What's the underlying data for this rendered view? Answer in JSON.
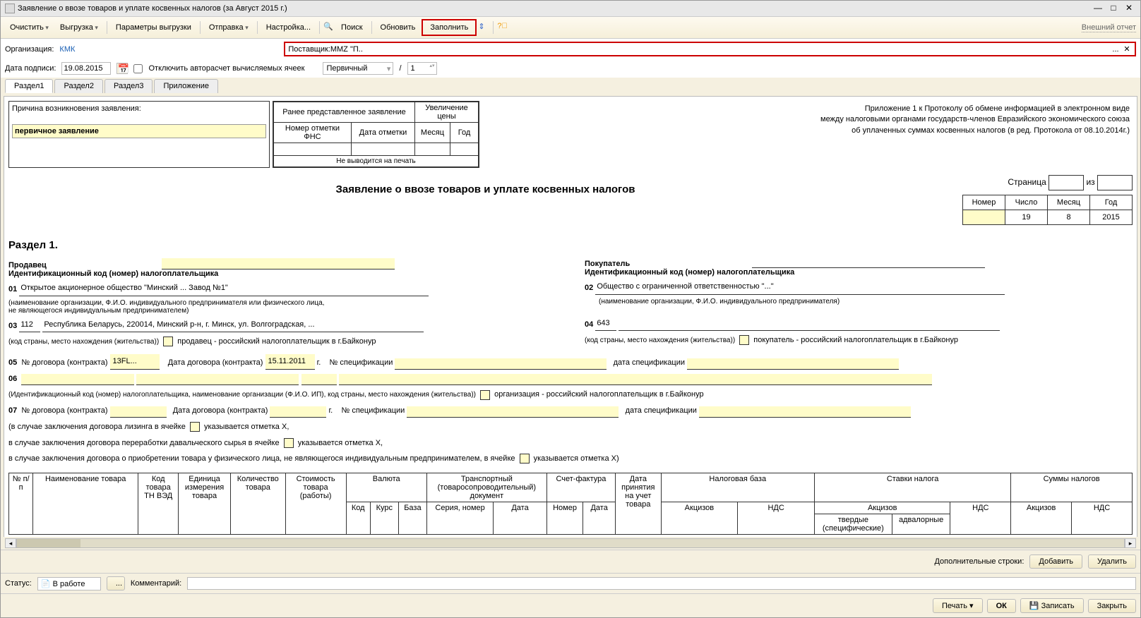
{
  "window": {
    "title": "Заявление о ввозе товаров и уплате косвенных налогов (за Август 2015 г.)"
  },
  "toolbar": {
    "clear": "Очистить",
    "unload": "Выгрузка",
    "unload_params": "Параметры выгрузки",
    "send": "Отправка",
    "settings": "Настройка...",
    "search": "Поиск",
    "refresh": "Обновить",
    "fill": "Заполнить",
    "ext_report": "Внешний отчет"
  },
  "header": {
    "org_label": "Организация:",
    "org": "КМК",
    "supplier_label": "Поставщик:",
    "supplier": "MMZ \"П..",
    "date_label": "Дата подписи:",
    "date": "19.08.2015",
    "autocalc_label": "Отключить авторасчет вычисляемых ячеек",
    "kind": "Первичный",
    "slash": "/",
    "num": "1"
  },
  "tabs": {
    "t1": "Раздел1",
    "t2": "Раздел2",
    "t3": "Раздел3",
    "t4": "Приложение"
  },
  "doc": {
    "reason_title": "Причина возникновения заявления:",
    "reason_val": "первичное заявление",
    "prev": {
      "title": "Ранее представленное заявление",
      "fns": "Номер отметки ФНС",
      "date": "Дата отметки",
      "noprint": "Не выводится на печать"
    },
    "increase": {
      "title": "Увеличение цены",
      "month": "Месяц",
      "year": "Год"
    },
    "appendix": {
      "l1": "Приложение 1 к Протоколу об обмене информацией в электронном виде",
      "l2": "между налоговыми органами государств-членов Евразийского экономического союза",
      "l3": "об уплаченных суммах косвенных налогов (в ред. Протокола от 08.10.2014г.)"
    },
    "title": "Заявление о ввозе товаров и уплате косвенных налогов",
    "page": {
      "label": "Страница",
      "of": "из",
      "num_h": "Номер",
      "day_h": "Число",
      "mon_h": "Месяц",
      "year_h": "Год",
      "day": "19",
      "mon": "8",
      "year": "2015"
    },
    "section_h": "Раздел 1.",
    "seller_h": "Продавец",
    "buyer_h": "Покупатель",
    "id_code": "Идентификационный код (номер) налогоплательщика",
    "l01": "01",
    "l01_text": "Открытое акционерное общество \"Минский ... Завод №1\"",
    "l01_sub1": "(наименование организации, Ф.И.О. индивидуального предпринимателя или физического лица,",
    "l01_sub2": "не являющегося индивидуальным предпринимателем)",
    "l02": "02",
    "l02_text": "Общество с ограниченной ответственностью \"...\"",
    "l02_sub": "(наименование организации, Ф.И.О. индивидуального предпринимателя)",
    "l03": "03",
    "l03_code": "112",
    "l03_addr": "Республика Беларусь, 220014, Минский р-н, г. Минск, ул. Волгоградская, ...",
    "l04": "04",
    "l04_code": "643",
    "addr_sub": "(код страны, место нахождения (жительства))",
    "baikonur_seller": "продавец - российский налогоплательщик в г.Байконур",
    "baikonur_buyer": "покупатель - российский налогоплательщик в г.Байконур",
    "l05": "05",
    "contract_num": "№ договора (контракта)",
    "contract_val": "13FL...",
    "contract_date_lbl": "Дата договора (контракта)",
    "contract_date": "15.11.2011",
    "g": "г.",
    "spec_num": "№ спецификации",
    "spec_date": "дата спецификации",
    "l06": "06",
    "l06_sub": "(Идентификационный код (номер) налогоплательщика, наименование организации (Ф.И.О. ИП), код страны, место нахождения (жительства))",
    "baikonur_org": "организация - российский налогоплательщик в г.Байконур",
    "l07": "07",
    "leasing": "(в случае заключения договора лизинга в ячейке",
    "mark_x": "указывается отметка Х,",
    "davai": "в случае заключения договора переработки давальческого сырья в ячейке",
    "fizlico": "в случае заключения договора о приобретении товара у физического лица, не являющегося индивидуальным предпринимателем, в ячейке",
    "mark_x_end": "указывается отметка Х)"
  },
  "table": {
    "c1": "№ п/п",
    "c2": "Наименование товара",
    "c3": "Код товара ТН ВЭД",
    "c4": "Единица измерения товара",
    "c5": "Количество товара",
    "c6": "Стоимость товара (работы)",
    "c7": "Валюта",
    "c8": "Транспортный (товаросопроводительный) документ",
    "c9": "Счет-фактура",
    "c10": "Дата принятия на учет товара",
    "c11": "Налоговая база",
    "c12": "Ставки налога",
    "c13": "Суммы налогов",
    "kod": "Код",
    "kurs": "Курс",
    "baza": "База",
    "seria": "Серия, номер",
    "data": "Дата",
    "nomer": "Номер",
    "akciz": "Акцизов",
    "nds": "НДС",
    "tverd": "твердые (специфические)",
    "adval": "адвалорные"
  },
  "extra": {
    "label": "Дополнительные строки:",
    "add": "Добавить",
    "del": "Удалить"
  },
  "status": {
    "label": "Статус:",
    "value": "В работе",
    "comment_label": "Комментарий:"
  },
  "bottom": {
    "print": "Печать",
    "ok": "ОК",
    "save": "Записать",
    "close": "Закрыть"
  }
}
